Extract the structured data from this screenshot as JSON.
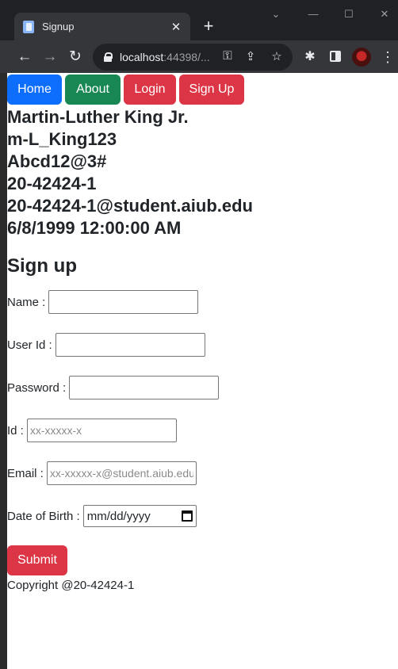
{
  "browser": {
    "tab_title": "Signup",
    "tab_close": "✕",
    "new_tab": "+",
    "url_host": "localhost",
    "url_rest": ":44398/...",
    "icons": [
      "favicon-icon",
      "back-icon",
      "forward-icon",
      "reload-icon",
      "lock-icon",
      "key-icon",
      "share-icon",
      "star-icon",
      "extensions-icon",
      "side-panel-icon",
      "profile-avatar",
      "menu-icon"
    ]
  },
  "nav": {
    "home": "Home",
    "about": "About",
    "login": "Login",
    "signup": "Sign Up"
  },
  "user_info": {
    "name": "Martin-Luther King Jr.",
    "user_id": "m-L_King123",
    "password": "Abcd12@3#",
    "id": "20-42424-1",
    "email": "20-42424-1@student.aiub.edu",
    "dob": "6/8/1999 12:00:00 AM"
  },
  "form": {
    "title": "Sign up",
    "name_label": "Name :",
    "userid_label": "User Id :",
    "password_label": "Password :",
    "id_label": "Id :",
    "id_placeholder": "xx-xxxxx-x",
    "email_label": "Email :",
    "email_placeholder": "xx-xxxxx-x@student.aiub.edu",
    "dob_label": "Date of Birth :",
    "dob_value": "mm/dd/yyyy",
    "submit": "Submit"
  },
  "footer": {
    "text": "Copyright @20-42424-1"
  },
  "colors": {
    "primary": "#0d6efd",
    "success": "#198754",
    "danger": "#dc3545",
    "chrome_bg": "#202124",
    "toolbar_bg": "#35363a"
  }
}
